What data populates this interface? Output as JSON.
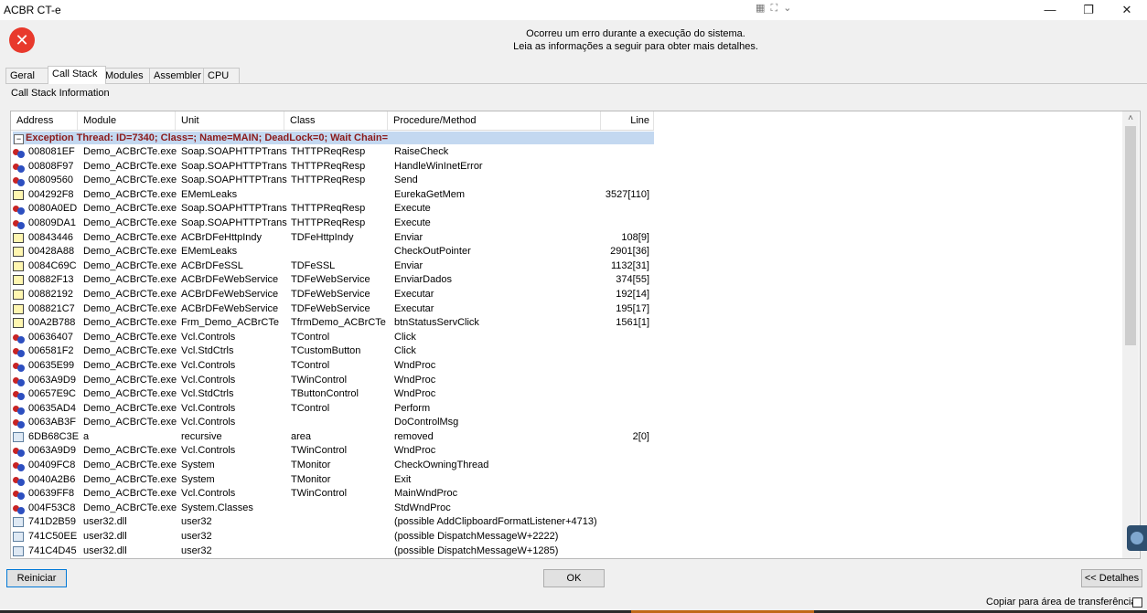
{
  "window": {
    "title": "ACBR CT-e",
    "controls": {
      "minimize": "—",
      "restore": "❐",
      "close": "✕"
    },
    "extra_icons": [
      "▦",
      "⛶",
      "⌄"
    ]
  },
  "header": {
    "icon": "✕",
    "line1": "Ocorreu um erro durante a execução do sistema.",
    "line2": "Leia as informações a seguir para obter mais detalhes."
  },
  "tabs": [
    {
      "label": "Geral"
    },
    {
      "label": "Call Stack"
    },
    {
      "label": "Modules"
    },
    {
      "label": "Assembler"
    },
    {
      "label": "CPU"
    }
  ],
  "active_tab": "Call Stack",
  "section_label": "Call Stack Information",
  "grid": {
    "columns": [
      "Address",
      "Module",
      "Unit",
      "Class",
      "Procedure/Method",
      "Line"
    ],
    "exception_row": "Exception Thread: ID=7340; Class=; Name=MAIN; DeadLock=0; Wait Chain=",
    "rows": [
      {
        "icon": "blue",
        "address": "008081EF",
        "module": "Demo_ACBrCTe.exe",
        "unit": "Soap.SOAPHTTPTrans",
        "class": "THTTPReqResp",
        "proc": "RaiseCheck",
        "line": ""
      },
      {
        "icon": "blue",
        "address": "00808F97",
        "module": "Demo_ACBrCTe.exe",
        "unit": "Soap.SOAPHTTPTrans",
        "class": "THTTPReqResp",
        "proc": "HandleWinInetError",
        "line": ""
      },
      {
        "icon": "blue",
        "address": "00809560",
        "module": "Demo_ACBrCTe.exe",
        "unit": "Soap.SOAPHTTPTrans",
        "class": "THTTPReqResp",
        "proc": "Send",
        "line": ""
      },
      {
        "icon": "yellow",
        "address": "004292F8",
        "module": "Demo_ACBrCTe.exe",
        "unit": "EMemLeaks",
        "class": "",
        "proc": "EurekaGetMem",
        "line": "3527[110]"
      },
      {
        "icon": "blue",
        "address": "0080A0ED",
        "module": "Demo_ACBrCTe.exe",
        "unit": "Soap.SOAPHTTPTrans",
        "class": "THTTPReqResp",
        "proc": "Execute",
        "line": ""
      },
      {
        "icon": "blue",
        "address": "00809DA1",
        "module": "Demo_ACBrCTe.exe",
        "unit": "Soap.SOAPHTTPTrans",
        "class": "THTTPReqResp",
        "proc": "Execute",
        "line": ""
      },
      {
        "icon": "yellow",
        "address": "00843446",
        "module": "Demo_ACBrCTe.exe",
        "unit": "ACBrDFeHttpIndy",
        "class": "TDFeHttpIndy",
        "proc": "Enviar",
        "line": "108[9]"
      },
      {
        "icon": "yellow",
        "address": "00428A88",
        "module": "Demo_ACBrCTe.exe",
        "unit": "EMemLeaks",
        "class": "",
        "proc": "CheckOutPointer",
        "line": "2901[36]"
      },
      {
        "icon": "yellow",
        "address": "0084C69C",
        "module": "Demo_ACBrCTe.exe",
        "unit": "ACBrDFeSSL",
        "class": "TDFeSSL",
        "proc": "Enviar",
        "line": "1132[31]"
      },
      {
        "icon": "yellow",
        "address": "00882F13",
        "module": "Demo_ACBrCTe.exe",
        "unit": "ACBrDFeWebService",
        "class": "TDFeWebService",
        "proc": "EnviarDados",
        "line": "374[55]"
      },
      {
        "icon": "yellow",
        "address": "00882192",
        "module": "Demo_ACBrCTe.exe",
        "unit": "ACBrDFeWebService",
        "class": "TDFeWebService",
        "proc": "Executar",
        "line": "192[14]"
      },
      {
        "icon": "yellow",
        "address": "008821C7",
        "module": "Demo_ACBrCTe.exe",
        "unit": "ACBrDFeWebService",
        "class": "TDFeWebService",
        "proc": "Executar",
        "line": "195[17]"
      },
      {
        "icon": "yellow",
        "address": "00A2B788",
        "module": "Demo_ACBrCTe.exe",
        "unit": "Frm_Demo_ACBrCTe",
        "class": "TfrmDemo_ACBrCTe",
        "proc": "btnStatusServClick",
        "line": "1561[1]"
      },
      {
        "icon": "blue",
        "address": "00636407",
        "module": "Demo_ACBrCTe.exe",
        "unit": "Vcl.Controls",
        "class": "TControl",
        "proc": "Click",
        "line": ""
      },
      {
        "icon": "blue",
        "address": "006581F2",
        "module": "Demo_ACBrCTe.exe",
        "unit": "Vcl.StdCtrls",
        "class": "TCustomButton",
        "proc": "Click",
        "line": ""
      },
      {
        "icon": "blue",
        "address": "00635E99",
        "module": "Demo_ACBrCTe.exe",
        "unit": "Vcl.Controls",
        "class": "TControl",
        "proc": "WndProc",
        "line": ""
      },
      {
        "icon": "blue",
        "address": "0063A9D9",
        "module": "Demo_ACBrCTe.exe",
        "unit": "Vcl.Controls",
        "class": "TWinControl",
        "proc": "WndProc",
        "line": ""
      },
      {
        "icon": "blue",
        "address": "00657E9C",
        "module": "Demo_ACBrCTe.exe",
        "unit": "Vcl.StdCtrls",
        "class": "TButtonControl",
        "proc": "WndProc",
        "line": ""
      },
      {
        "icon": "blue",
        "address": "00635AD4",
        "module": "Demo_ACBrCTe.exe",
        "unit": "Vcl.Controls",
        "class": "TControl",
        "proc": "Perform",
        "line": ""
      },
      {
        "icon": "blue",
        "address": "0063AB3F",
        "module": "Demo_ACBrCTe.exe",
        "unit": "Vcl.Controls",
        "class": "",
        "proc": "DoControlMsg",
        "line": ""
      },
      {
        "icon": "gray",
        "address": "6DB68C3E",
        "module": "a",
        "unit": "recursive",
        "class": "area",
        "proc": "removed",
        "line": "2[0]"
      },
      {
        "icon": "blue",
        "address": "0063A9D9",
        "module": "Demo_ACBrCTe.exe",
        "unit": "Vcl.Controls",
        "class": "TWinControl",
        "proc": "WndProc",
        "line": ""
      },
      {
        "icon": "blue",
        "address": "00409FC8",
        "module": "Demo_ACBrCTe.exe",
        "unit": "System",
        "class": "TMonitor",
        "proc": "CheckOwningThread",
        "line": ""
      },
      {
        "icon": "blue",
        "address": "0040A2B6",
        "module": "Demo_ACBrCTe.exe",
        "unit": "System",
        "class": "TMonitor",
        "proc": "Exit",
        "line": ""
      },
      {
        "icon": "blue",
        "address": "00639FF8",
        "module": "Demo_ACBrCTe.exe",
        "unit": "Vcl.Controls",
        "class": "TWinControl",
        "proc": "MainWndProc",
        "line": ""
      },
      {
        "icon": "blue",
        "address": "004F53C8",
        "module": "Demo_ACBrCTe.exe",
        "unit": "System.Classes",
        "class": "",
        "proc": "StdWndProc",
        "line": ""
      },
      {
        "icon": "gray",
        "address": "741D2B59",
        "module": "user32.dll",
        "unit": "user32",
        "class": "",
        "proc": "(possible AddClipboardFormatListener+4713)",
        "line": ""
      },
      {
        "icon": "gray",
        "address": "741C50EE",
        "module": "user32.dll",
        "unit": "user32",
        "class": "",
        "proc": "(possible DispatchMessageW+2222)",
        "line": ""
      },
      {
        "icon": "gray",
        "address": "741C4D45",
        "module": "user32.dll",
        "unit": "user32",
        "class": "",
        "proc": "(possible DispatchMessageW+1285)",
        "line": ""
      }
    ]
  },
  "buttons": {
    "restart": "Reiniciar",
    "ok": "OK",
    "details": "<< Detalhes"
  },
  "copy_label": "Copiar para área de transferência"
}
